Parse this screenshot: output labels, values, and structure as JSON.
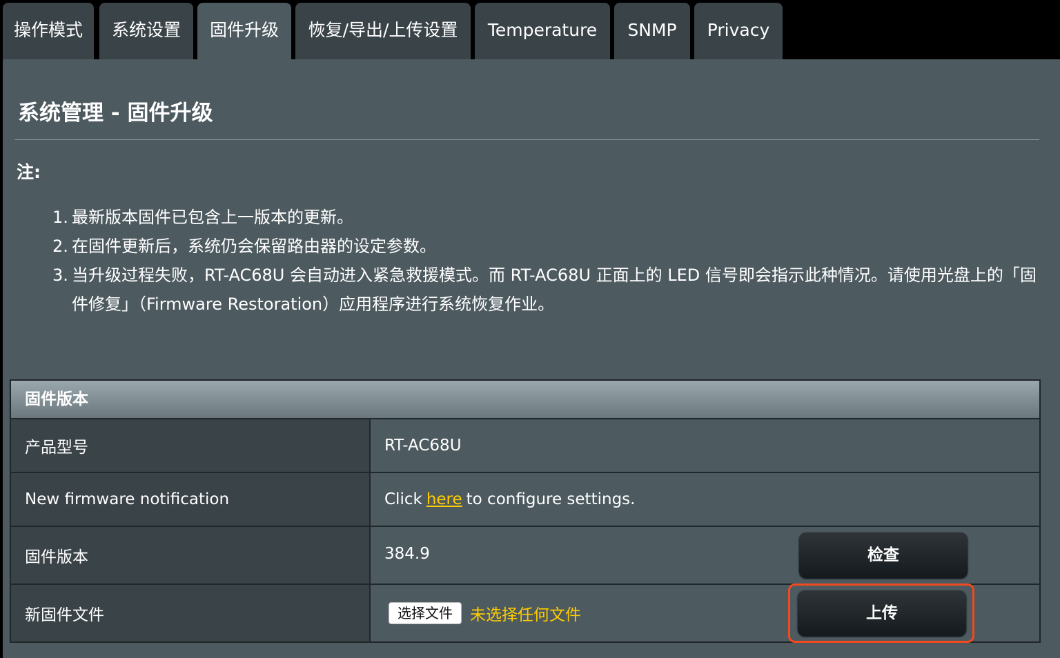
{
  "tabs": [
    {
      "label": "操作模式",
      "active": false
    },
    {
      "label": "系统设置",
      "active": false
    },
    {
      "label": "固件升级",
      "active": true
    },
    {
      "label": "恢复/导出/上传设置",
      "active": false
    },
    {
      "label": "Temperature",
      "active": false
    },
    {
      "label": "SNMP",
      "active": false
    },
    {
      "label": "Privacy",
      "active": false
    }
  ],
  "page_title": "系统管理 - 固件升级",
  "note_label": "注:",
  "notes": [
    {
      "num": "1.",
      "text": "最新版本固件已包含上一版本的更新。"
    },
    {
      "num": "2.",
      "text": "在固件更新后，系统仍会保留路由器的设定参数。"
    },
    {
      "num": "3.",
      "text": "当升级过程失败，RT-AC68U 会自动进入紧急救援模式。而 RT-AC68U 正面上的 LED 信号即会指示此种情况。请使用光盘上的「固件修复」（Firmware Restoration）应用程序进行系统恢复作业。"
    }
  ],
  "firmware_table": {
    "header": "固件版本",
    "rows": {
      "model": {
        "label": "产品型号",
        "value": "RT-AC68U"
      },
      "notification": {
        "label": "New firmware notification",
        "prefix": "Click",
        "link": "here",
        "suffix": "to configure settings."
      },
      "version": {
        "label": "固件版本",
        "value": "384.9",
        "button": "检查"
      },
      "new_file": {
        "label": "新固件文件",
        "choose_button": "选择文件",
        "status": "未选择任何文件",
        "upload_button": "上传"
      }
    }
  },
  "colors": {
    "accent_link": "#ffcc00",
    "highlight_border": "#f04a1e",
    "panel_bg": "#4d5a60",
    "tab_bg": "#3a4348"
  }
}
